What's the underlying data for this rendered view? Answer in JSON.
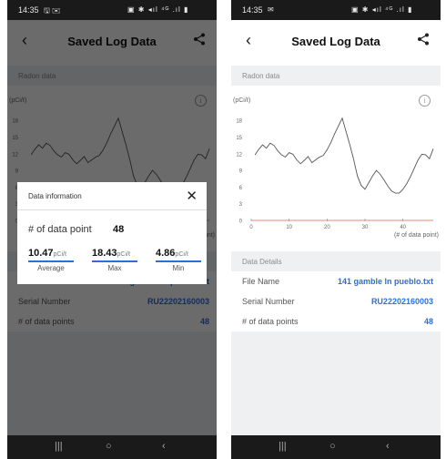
{
  "status_bar": {
    "left": {
      "time": "14:35",
      "icons": "🖫 ✉"
    },
    "right": {
      "time": "14:35",
      "icons": "✉"
    },
    "system_icons": "▣ ✱ ◂ıl ⁴ᴳ .ıl ▮"
  },
  "header": {
    "back_icon": "‹",
    "title": "Saved Log Data",
    "share_icon": "share-icon"
  },
  "radon": {
    "section_label": "Radon data",
    "info_icon": "i"
  },
  "chart_data": {
    "type": "line",
    "title": "",
    "ylabel": "(pCi/ℓ)",
    "xlabel": "(# of data point)",
    "xlim": [
      0,
      48
    ],
    "ylim": [
      0,
      20
    ],
    "yticks": [
      "18",
      "15",
      "12",
      "9",
      "6",
      "3",
      "0"
    ],
    "xticks": [
      "0",
      "10",
      "20",
      "30",
      "40"
    ],
    "threshold": 0,
    "colors": {
      "line": "#555555",
      "threshold": "#e88a7a"
    },
    "series": [
      {
        "values": [
          11.8,
          12.8,
          13.6,
          13.0,
          13.9,
          13.5,
          12.5,
          11.8,
          11.4,
          12.2,
          11.9,
          10.9,
          10.2,
          10.8,
          11.5,
          10.4,
          10.9,
          11.4,
          11.7,
          12.7,
          14.0,
          15.6,
          17.0,
          18.4,
          16.0,
          13.6,
          11.0,
          8.0,
          6.3,
          5.6,
          6.8,
          8.0,
          9.0,
          8.3,
          7.3,
          6.2,
          5.3,
          4.9,
          4.9,
          5.6,
          6.6,
          7.9,
          9.4,
          10.9,
          11.9,
          11.8,
          11.1,
          12.9
        ]
      }
    ]
  },
  "details": {
    "section_label": "Data Details",
    "rows": [
      {
        "key": "File Name",
        "value": "141 gamble ln pueblo.txt"
      },
      {
        "key": "Serial Number",
        "value": "RU22202160003"
      },
      {
        "key": "# of data points",
        "value": "48"
      }
    ]
  },
  "dialog": {
    "title": "Data information",
    "close_icon": "✕",
    "points_label": "# of data point",
    "points_value": "48",
    "unit": "pCi/ℓ",
    "stats": [
      {
        "value": "10.47",
        "label": "Average"
      },
      {
        "value": "18.43",
        "label": "Max"
      },
      {
        "value": "4.86",
        "label": "Min"
      }
    ]
  },
  "navbar": {
    "recent": "|||",
    "home": "○",
    "back": "‹"
  }
}
